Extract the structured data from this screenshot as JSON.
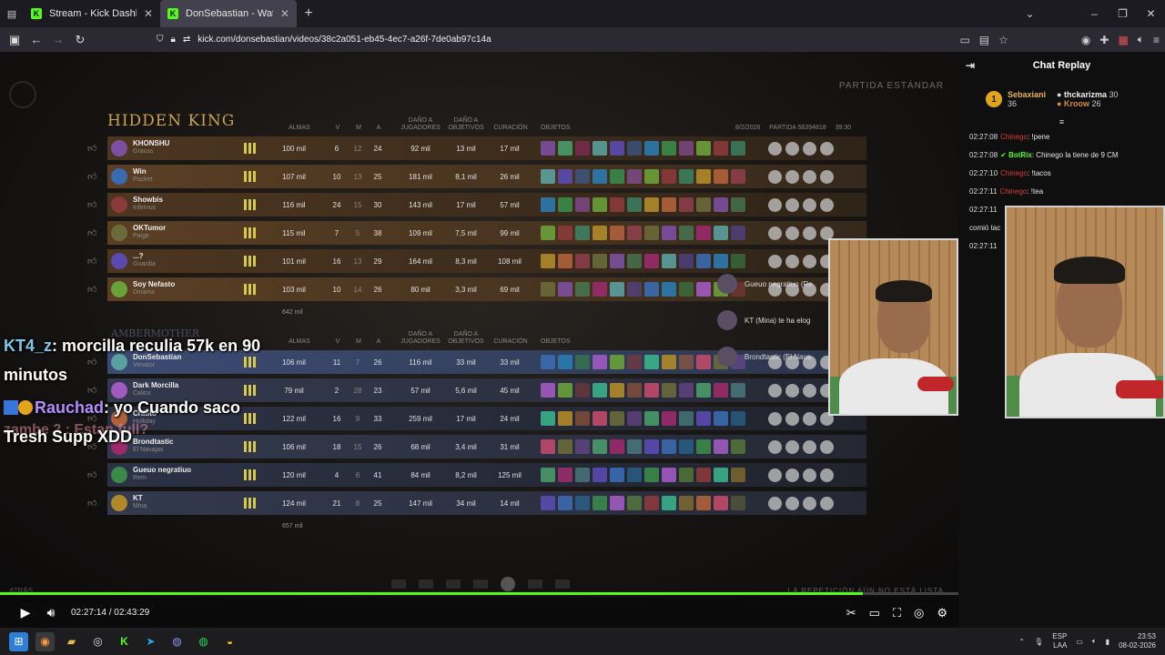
{
  "browser": {
    "tabs": [
      {
        "label": "Stream - Kick Dashboard",
        "active": false
      },
      {
        "label": "DonSebastian - Watch the VOD",
        "active": true
      }
    ],
    "url": "kick.com/donsebastian/videos/38c2a051-eb45-4ec7-a26f-7de0ab97c14a"
  },
  "scoreboard": {
    "mode": "PARTIDA ESTÁNDAR",
    "team1_name": "HIDDEN KING",
    "team2_name": "AMBERMOTHER",
    "date": "8/2/2026",
    "match_label": "PARTIDA 56394818",
    "duration": "39:30",
    "headers": {
      "souls": "ALMAS",
      "k": "V",
      "d": "M",
      "a": "A",
      "player_dmg": "DAÑO A JUGADORES",
      "obj_dmg": "DAÑO A OBJETIVOS",
      "healing": "CURACIÓN",
      "items": "OBJETOS"
    },
    "team1": [
      {
        "name": "KHONSHU",
        "hero": "Grauss",
        "souls": "100 mil",
        "k": "6",
        "d": "12",
        "a": "24",
        "dmg": "92 mil",
        "obj": "13 mil",
        "heal": "17 mil"
      },
      {
        "name": "Win",
        "hero": "Pocket",
        "souls": "107 mil",
        "k": "10",
        "d": "13",
        "a": "25",
        "dmg": "181 mil",
        "obj": "8,1 mil",
        "heal": "26 mil"
      },
      {
        "name": "Showbis",
        "hero": "Infernus",
        "souls": "116 mil",
        "k": "24",
        "d": "15",
        "a": "30",
        "dmg": "143 mil",
        "obj": "17 mil",
        "heal": "57 mil"
      },
      {
        "name": "OKTumor",
        "hero": "Paige",
        "souls": "115 mil",
        "k": "7",
        "d": "5",
        "a": "38",
        "dmg": "109 mil",
        "obj": "7,5 mil",
        "heal": "99 mil"
      },
      {
        "name": "...?",
        "hero": "Guardia",
        "souls": "101 mil",
        "k": "16",
        "d": "13",
        "a": "29",
        "dmg": "164 mil",
        "obj": "8,3 mil",
        "heal": "108 mil"
      },
      {
        "name": "Soy Nefasto",
        "hero": "Dinamo",
        "souls": "103 mil",
        "k": "10",
        "d": "14",
        "a": "26",
        "dmg": "80 mil",
        "obj": "3,3 mil",
        "heal": "69 mil"
      }
    ],
    "team1_total": "642 mil",
    "team2": [
      {
        "name": "DonSebastian",
        "hero": "Venator",
        "souls": "106 mil",
        "k": "11",
        "d": "7",
        "a": "26",
        "dmg": "116 mil",
        "obj": "33 mil",
        "heal": "33 mil"
      },
      {
        "name": "Dark Morcilla",
        "hero": "Calico",
        "souls": "79 mil",
        "k": "2",
        "d": "28",
        "a": "23",
        "dmg": "57 mil",
        "obj": "5,6 mil",
        "heal": "45 mil"
      },
      {
        "name": "Cratito",
        "hero": "Holliday",
        "souls": "122 mil",
        "k": "16",
        "d": "9",
        "a": "33",
        "dmg": "259 mil",
        "obj": "17 mil",
        "heal": "24 mil"
      },
      {
        "name": "Brondtastic",
        "hero": "El Navajas",
        "souls": "106 mil",
        "k": "18",
        "d": "15",
        "a": "26",
        "dmg": "68 mil",
        "obj": "3,4 mil",
        "heal": "31 mil"
      },
      {
        "name": "Gueuo negratiuo",
        "hero": "Rem",
        "souls": "120 mil",
        "k": "4",
        "d": "6",
        "a": "41",
        "dmg": "84 mil",
        "obj": "8,2 mil",
        "heal": "125 mil"
      },
      {
        "name": "KT",
        "hero": "Mina",
        "souls": "124 mil",
        "k": "21",
        "d": "8",
        "a": "25",
        "dmg": "147 mil",
        "obj": "34 mil",
        "heal": "14 mil"
      }
    ],
    "team2_total": "657 mil",
    "feed": [
      "Gueuo negratiuo (Re",
      "KT (Mina) te ha elog",
      "Brondtastic (El Nava"
    ],
    "back_label": "ATRÁS",
    "replay_note": "LA REPETICIÓN AÚN NO ESTÁ LISTA"
  },
  "overlay_chat": {
    "line1_user": "KT4_z",
    "line1_text": ": morcilla reculia 57k en 90 minutos",
    "line2_user": "Rauchad",
    "line2_text": ": yo Cuando saco Tresh Supp XDD",
    "ghost_text": "zambe 2 : Estan full?"
  },
  "player": {
    "time": "02:27:14 / 02:43:29",
    "progress": 0.9
  },
  "chat": {
    "title": "Chat Replay",
    "pinned": [
      {
        "name": "Sebaxiani",
        "count": "36"
      },
      {
        "name": "thckarizma",
        "count": "30"
      },
      {
        "name": "Kroow",
        "count": "26"
      }
    ],
    "messages": [
      {
        "time": "02:27:08",
        "user": "Chinego",
        "text": ": !pene",
        "style": "r"
      },
      {
        "time": "02:27:08",
        "user": "BotRix",
        "text": ": Chinego la tiene de 9 CM",
        "style": "g"
      },
      {
        "time": "02:27:10",
        "user": "Chinego",
        "text": ": !tacos",
        "style": "r"
      },
      {
        "time": "02:27:11",
        "user": "Chinego",
        "text": ": !tea",
        "style": "r"
      },
      {
        "time": "02:27:11",
        "user": "",
        "text": "",
        "style": "r"
      },
      {
        "time": "",
        "user": "",
        "text": "comió tac",
        "style": "r"
      },
      {
        "time": "02:27:11",
        "user": "",
        "text": "",
        "style": "r"
      }
    ]
  },
  "taskbar": {
    "lang": "ESP",
    "lang2": "LAA",
    "time": "23:53",
    "date": "08-02-2026"
  }
}
